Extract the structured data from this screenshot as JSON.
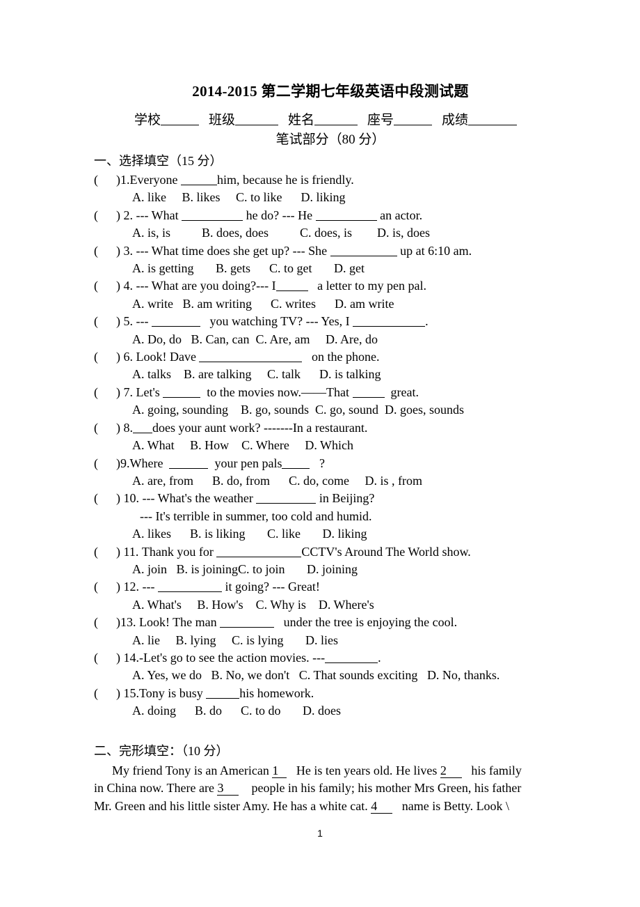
{
  "document": {
    "title": "2014-2015 第二学期七年级英语中段测试题",
    "identity_fields": [
      "学校",
      "班级",
      "姓名",
      "座号",
      "成绩"
    ],
    "subtitle": "笔试部分（80 分）",
    "page_number": "1"
  },
  "section_one": {
    "heading": "一、选择填空（15 分）",
    "questions": [
      {
        "paren": "(",
        "close_paren": ")",
        "number": "1.",
        "stem_before": "Everyone",
        "stem_after": "him, because he is friendly.",
        "options": [
          "A. like",
          "B. likes",
          "C. to like",
          "D. liking"
        ]
      },
      {
        "paren": "(",
        "close_paren": ")",
        "number": "2.",
        "stem_before": "--- What",
        "stem_mid": "he do? --- He",
        "stem_after": "an actor.",
        "options": [
          "A. is, is",
          "B. does, does",
          "C. does, is",
          "D. is, does"
        ]
      },
      {
        "paren": "(",
        "close_paren": ")",
        "number": "3.",
        "stem_before": "--- What time does she get up? --- She",
        "stem_after": "up at 6:10 am.",
        "options": [
          "A. is getting",
          "B. gets",
          "C. to get",
          "D. get"
        ]
      },
      {
        "paren": "(",
        "close_paren": ")",
        "number": "4.",
        "stem_before": "--- What are you doing?--- I",
        "stem_after": "a letter to my pen pal.",
        "options": [
          "A. write",
          "B. am writing",
          "C. writes",
          "D. am write"
        ]
      },
      {
        "paren": "(",
        "close_paren": ")",
        "number": "5.",
        "stem_before": "---",
        "stem_mid": "you watching TV? --- Yes, I",
        "stem_after": ".",
        "options": [
          "A. Do, do",
          "B. Can, can",
          "C. Are, am",
          "D. Are, do"
        ]
      },
      {
        "paren": "(",
        "close_paren": ")",
        "number": "6.",
        "stem_before": "Look! Dave",
        "stem_after": "on the phone.",
        "options": [
          "A. talks",
          "B. are talking",
          "C. talk",
          "D. is talking"
        ]
      },
      {
        "paren": "(",
        "close_paren": ")",
        "number": "7.",
        "stem_before": "Let's",
        "stem_mid": "to the movies now.——That",
        "stem_after": "great.",
        "options": [
          "A. going, sounding",
          "B. go, sounds",
          "C. go, sound",
          "D. goes, sounds"
        ]
      },
      {
        "paren": "(",
        "close_paren": ")",
        "number": "8.",
        "stem_after": "does your aunt work? -------In a restaurant.",
        "options": [
          "A. What",
          "B. How",
          "C. Where",
          "D. Which"
        ]
      },
      {
        "paren": "(",
        "close_paren": ")",
        "number": "9.",
        "stem_before": "Where",
        "stem_mid": "your pen pals",
        "stem_after": "?",
        "options": [
          "A. are, from",
          "B. do, from",
          "C. do, come",
          "D. is , from"
        ]
      },
      {
        "paren": "(",
        "close_paren": ")",
        "number": "10.",
        "stem_before": "--- What's the weather",
        "stem_after": "in Beijing?",
        "extra_line": "--- It's terrible in summer, too cold and humid.",
        "options": [
          "A. likes",
          "B. is liking",
          "C. like",
          "D. liking"
        ]
      },
      {
        "paren": "(",
        "close_paren": ")",
        "number": "11.",
        "stem_before": "Thank you for",
        "stem_after": "CCTV's Around The World show.",
        "options": [
          "A. join",
          "B. is joining",
          "C. to join",
          "D. joining"
        ]
      },
      {
        "paren": "(",
        "close_paren": ")",
        "number": "12.",
        "stem_before": "---",
        "stem_after": "it going? --- Great!",
        "options": [
          "A. What's",
          "B. How's",
          "C. Why is",
          "D. Where's"
        ]
      },
      {
        "paren": "(",
        "close_paren": ")",
        "number": "13.",
        "stem_before": "Look! The man",
        "stem_after": "under the tree is enjoying the cool.",
        "options": [
          "A. lie",
          "B. lying",
          "C. is lying",
          "D. lies"
        ]
      },
      {
        "paren": "(",
        "close_paren": ")",
        "number": "14.",
        "stem_before": "-Let's go to see the action movies. ---",
        "stem_after": ".",
        "options": [
          "A. Yes, we do",
          "B. No, we don't",
          "C. That sounds exciting",
          "D. No, thanks."
        ]
      },
      {
        "paren": "(",
        "close_paren": ")",
        "number": "15.",
        "stem_before": "Tony is busy",
        "stem_after": "his homework.",
        "options": [
          "A. doing",
          "B. do",
          "C. to do",
          "D. does"
        ]
      }
    ]
  },
  "section_two": {
    "heading": "二、完形填空：（10 分）",
    "line1_a": "My friend Tony is an American",
    "blank1": "1",
    "line1_b": "He is ten years old. He lives",
    "blank2": "2",
    "line1_c": "his family",
    "line2_a": "in China now. There are",
    "blank3": "3",
    "line2_b": "people in his family; his mother Mrs Green, his father",
    "line3_a": "Mr. Green and his little sister Amy. He has a white cat.",
    "blank4": "4",
    "line3_b": "name is Betty. Look \\"
  }
}
